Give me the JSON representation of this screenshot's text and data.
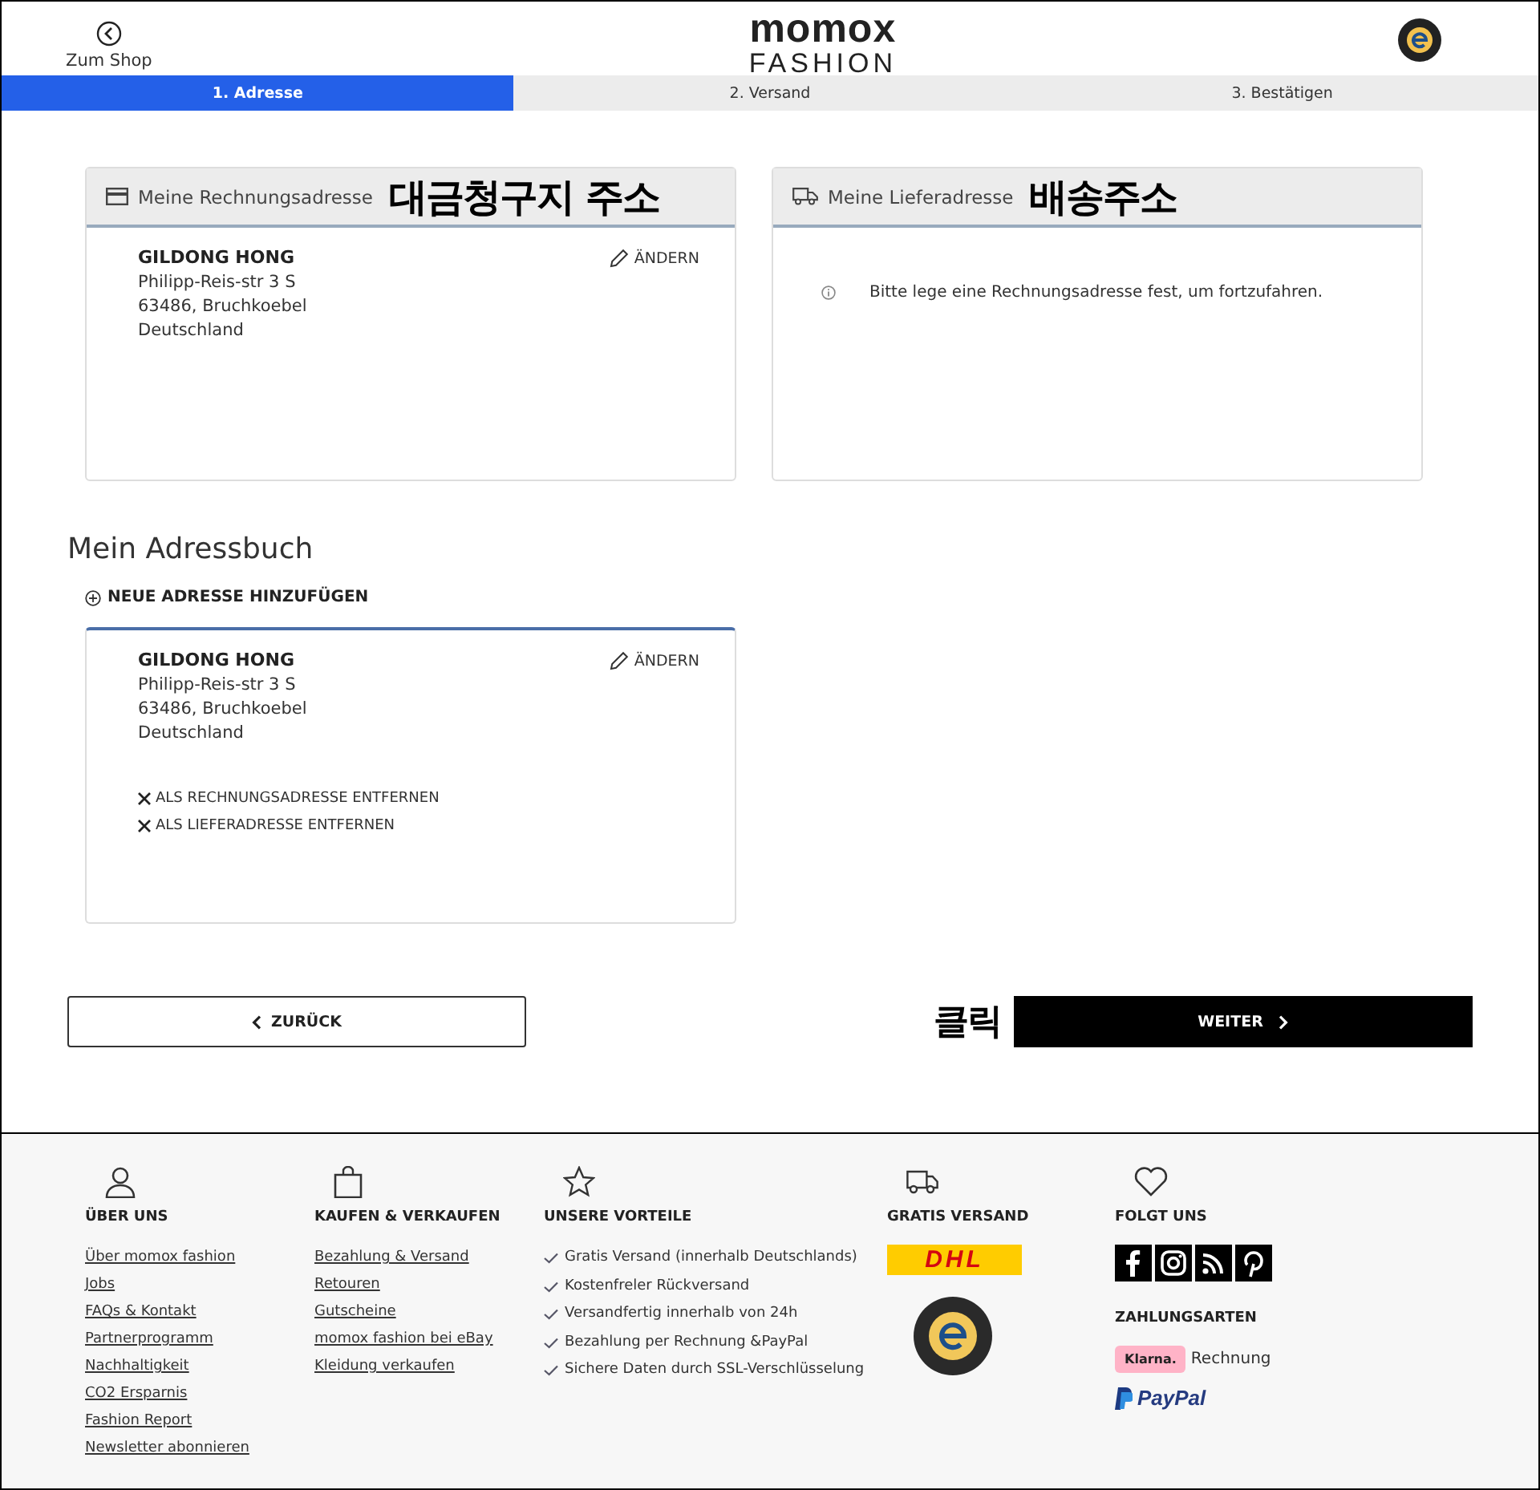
{
  "header": {
    "back_link": "Zum Shop",
    "logo_top": "momox",
    "logo_bottom": "FASHION"
  },
  "steps": [
    {
      "label": "1. Adresse",
      "selected": true
    },
    {
      "label": "2. Versand",
      "selected": false
    },
    {
      "label": "3. Bestätigen",
      "selected": false
    }
  ],
  "billing": {
    "title": "Meine Rechnungsadresse",
    "annotation": "대금청구지 주소",
    "name": "GILDONG HONG",
    "lines": [
      "Philipp-Reis-str 3 S",
      "63486, Bruchkoebel",
      "Deutschland"
    ],
    "edit": "ÄNDERN"
  },
  "delivery": {
    "title": "Meine Lieferadresse",
    "annotation": "배송주소",
    "message": "Bitte lege eine Rechnungsadresse fest, um fortzufahren."
  },
  "address_book": {
    "title": "Mein Adressbuch",
    "add": "NEUE ADRESSE HINZUFÜGEN",
    "entries": [
      {
        "name": "GILDONG HONG",
        "lines": [
          "Philipp-Reis-str 3 S",
          "63486, Bruchkoebel",
          "Deutschland"
        ],
        "edit": "ÄNDERN",
        "actions": [
          "ALS RECHNUNGSADRESSE ENTFERNEN",
          "ALS LIEFERADRESSE ENTFERNEN"
        ]
      }
    ]
  },
  "nav": {
    "back": "ZURÜCK",
    "next": "WEITER",
    "annotation": "클릭"
  },
  "footer": {
    "columns": [
      {
        "kind": "links",
        "title": "ÜBER UNS",
        "items": [
          "Über momox fashion",
          "Jobs",
          "FAQs & Kontakt",
          "Partnerprogramm",
          "Nachhaltigkeit",
          "CO2 Ersparnis",
          "Fashion Report",
          "Newsletter abonnieren"
        ]
      },
      {
        "kind": "links",
        "title": "KAUFEN & VERKAUFEN",
        "items": [
          "Bezahlung & Versand",
          "Retouren",
          "Gutscheine",
          "momox fashion bei eBay",
          "Kleidung verkaufen"
        ]
      },
      {
        "kind": "checks",
        "title": "UNSERE VORTEILE",
        "items": [
          "Gratis Versand (innerhalb Deutschlands)",
          "Kostenfreler Rückversand",
          "Versandfertig innerhalb von 24h",
          "Bezahlung per Rechnung &PayPal",
          "Sichere Daten durch SSL-Verschlüsselung"
        ]
      },
      {
        "kind": "shipping",
        "title": "GRATIS VERSAND",
        "carrier": "DHL"
      },
      {
        "kind": "social",
        "title": "FOLGT UNS",
        "payments_title": "ZAHLUNGSARTEN",
        "klarna": "Klarna.",
        "klarna_label": "Rechnung",
        "paypal": "PayPal"
      }
    ]
  }
}
